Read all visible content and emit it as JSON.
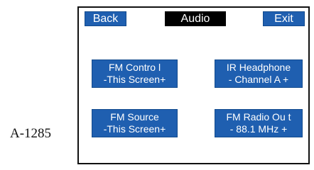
{
  "figure_label": "A-1285",
  "header": {
    "back_label": "Back",
    "title": "Audio",
    "exit_label": "Exit"
  },
  "tiles": [
    {
      "line1": "FM Contro l",
      "line2": "-This Screen+"
    },
    {
      "line1": "IR Headphone",
      "line2": "- Channel  A +"
    },
    {
      "line1": "FM Source",
      "line2": "-This Screen+"
    },
    {
      "line1": "FM Radio Ou t",
      "line2": "-  88.1 MHz  +"
    }
  ],
  "colors": {
    "button_blue": "#1f5fb0",
    "title_black": "#000000",
    "screen_border": "#111111"
  }
}
